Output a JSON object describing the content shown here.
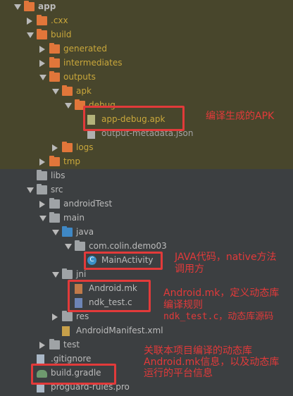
{
  "tree": [
    {
      "label": "app",
      "level": 0,
      "expanded": true,
      "icon": "folder-icon",
      "bold": true,
      "hl": true
    },
    {
      "label": ".cxx",
      "level": 1,
      "expanded": false,
      "icon": "folder-icon",
      "hl": true,
      "color": "gold"
    },
    {
      "label": "build",
      "level": 1,
      "expanded": true,
      "icon": "folder-icon",
      "hl": true,
      "color": "gold"
    },
    {
      "label": "generated",
      "level": 2,
      "expanded": false,
      "icon": "folder-icon",
      "hl": true,
      "color": "gold"
    },
    {
      "label": "intermediates",
      "level": 2,
      "expanded": false,
      "icon": "folder-icon",
      "hl": true,
      "color": "gold"
    },
    {
      "label": "outputs",
      "level": 2,
      "expanded": true,
      "icon": "folder-icon",
      "hl": true,
      "color": "gold"
    },
    {
      "label": "apk",
      "level": 3,
      "expanded": true,
      "icon": "folder-icon",
      "hl": true,
      "color": "gold"
    },
    {
      "label": "debug",
      "level": 4,
      "expanded": true,
      "icon": "folder-icon",
      "hl": true,
      "color": "gold"
    },
    {
      "label": "app-debug.apk",
      "level": 5,
      "icon": "apk-file-icon",
      "hl": true,
      "color": "gold"
    },
    {
      "label": "output-metadata.json",
      "level": 5,
      "icon": "json-file-icon",
      "hl": true,
      "color": "dim"
    },
    {
      "label": "logs",
      "level": 3,
      "expanded": false,
      "icon": "folder-icon",
      "hl": true,
      "color": "gold"
    },
    {
      "label": "tmp",
      "level": 2,
      "expanded": false,
      "icon": "folder-icon",
      "hl": true,
      "color": "gold"
    },
    {
      "label": "libs",
      "level": 1,
      "icon": "folder-icon"
    },
    {
      "label": "src",
      "level": 1,
      "expanded": true,
      "icon": "folder-icon"
    },
    {
      "label": "androidTest",
      "level": 2,
      "expanded": false,
      "icon": "folder-icon"
    },
    {
      "label": "main",
      "level": 2,
      "expanded": true,
      "icon": "folder-icon"
    },
    {
      "label": "java",
      "level": 3,
      "expanded": true,
      "icon": "blue-folder-icon"
    },
    {
      "label": "com.colin.demo03",
      "level": 4,
      "expanded": true,
      "icon": "package-icon"
    },
    {
      "label": "MainActivity",
      "level": 5,
      "icon": "class-icon"
    },
    {
      "label": "jni",
      "level": 3,
      "expanded": true,
      "icon": "folder-icon"
    },
    {
      "label": "Android.mk",
      "level": 4,
      "icon": "mk-file-icon"
    },
    {
      "label": "ndk_test.c",
      "level": 4,
      "icon": "c-file-icon"
    },
    {
      "label": "res",
      "level": 3,
      "expanded": false,
      "icon": "res-folder-icon"
    },
    {
      "label": "AndroidManifest.xml",
      "level": 3,
      "icon": "xml-file-icon"
    },
    {
      "label": "test",
      "level": 2,
      "expanded": false,
      "icon": "folder-icon"
    },
    {
      "label": ".gitignore",
      "level": 1,
      "icon": "gitignore-file-icon"
    },
    {
      "label": "build.gradle",
      "level": 1,
      "icon": "gradle-file-icon"
    },
    {
      "label": "proguard-rules.pro",
      "level": 1,
      "icon": "pro-file-icon"
    }
  ],
  "annotations": {
    "apk": "编译生成的APK",
    "java_line1": "JAVA代码，native方法",
    "java_line2": "调用方",
    "jni_line1": "Android.mk，定义动态库",
    "jni_line2": "编译规则",
    "jni_line3": "ndk_test.c，动态库源码",
    "gradle_line1": "关联本项目编译的动态库",
    "gradle_line2": "Android.mk信息，以及动态库",
    "gradle_line3": "运行的平台信息"
  },
  "colors": {
    "background": "#3c3f41",
    "highlight": "#48462c",
    "annotation": "#e23a3a"
  }
}
